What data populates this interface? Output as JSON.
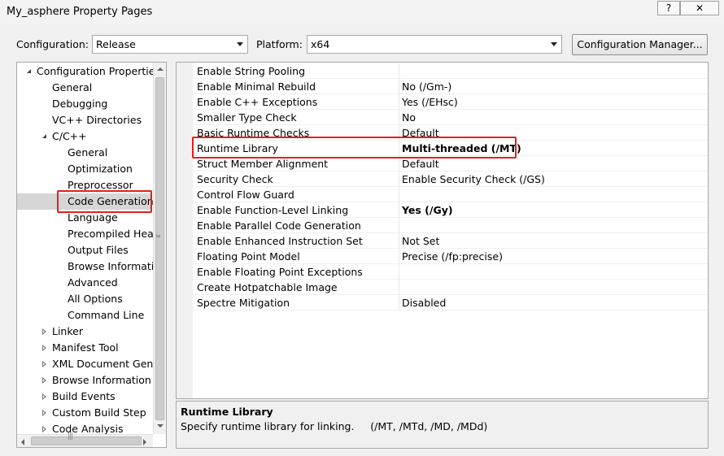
{
  "window": {
    "title": "My_asphere Property Pages",
    "help_glyph": "?",
    "close_glyph": "✕"
  },
  "config": {
    "configuration_label": "Configuration:",
    "configuration_value": "Release",
    "platform_label": "Platform:",
    "platform_value": "x64",
    "manager_button": "Configuration Manager..."
  },
  "tree": {
    "items": [
      {
        "label": "Configuration Properties",
        "level": 0,
        "expander": "open"
      },
      {
        "label": "General",
        "level": 1,
        "expander": "none"
      },
      {
        "label": "Debugging",
        "level": 1,
        "expander": "none"
      },
      {
        "label": "VC++ Directories",
        "level": 1,
        "expander": "none"
      },
      {
        "label": "C/C++",
        "level": 1,
        "expander": "open"
      },
      {
        "label": "General",
        "level": 2,
        "expander": "none"
      },
      {
        "label": "Optimization",
        "level": 2,
        "expander": "none"
      },
      {
        "label": "Preprocessor",
        "level": 2,
        "expander": "none"
      },
      {
        "label": "Code Generation",
        "level": 2,
        "expander": "none",
        "selected": true
      },
      {
        "label": "Language",
        "level": 2,
        "expander": "none"
      },
      {
        "label": "Precompiled Head",
        "level": 2,
        "expander": "none"
      },
      {
        "label": "Output Files",
        "level": 2,
        "expander": "none"
      },
      {
        "label": "Browse Informatio",
        "level": 2,
        "expander": "none"
      },
      {
        "label": "Advanced",
        "level": 2,
        "expander": "none"
      },
      {
        "label": "All Options",
        "level": 2,
        "expander": "none"
      },
      {
        "label": "Command Line",
        "level": 2,
        "expander": "none"
      },
      {
        "label": "Linker",
        "level": 1,
        "expander": "closed"
      },
      {
        "label": "Manifest Tool",
        "level": 1,
        "expander": "closed"
      },
      {
        "label": "XML Document Gene",
        "level": 1,
        "expander": "closed"
      },
      {
        "label": "Browse Information",
        "level": 1,
        "expander": "closed"
      },
      {
        "label": "Build Events",
        "level": 1,
        "expander": "closed"
      },
      {
        "label": "Custom Build Step",
        "level": 1,
        "expander": "closed"
      },
      {
        "label": "Code Analysis",
        "level": 1,
        "expander": "closed"
      }
    ]
  },
  "properties": [
    {
      "name": "Enable String Pooling",
      "value": ""
    },
    {
      "name": "Enable Minimal Rebuild",
      "value": "No (/Gm-)"
    },
    {
      "name": "Enable C++ Exceptions",
      "value": "Yes (/EHsc)"
    },
    {
      "name": "Smaller Type Check",
      "value": "No"
    },
    {
      "name": "Basic Runtime Checks",
      "value": "Default"
    },
    {
      "name": "Runtime Library",
      "value": "Multi-threaded (/MT)",
      "bold": true,
      "highlighted": true
    },
    {
      "name": "Struct Member Alignment",
      "value": "Default"
    },
    {
      "name": "Security Check",
      "value": "Enable Security Check (/GS)"
    },
    {
      "name": "Control Flow Guard",
      "value": ""
    },
    {
      "name": "Enable Function-Level Linking",
      "value": "Yes (/Gy)",
      "bold": true
    },
    {
      "name": "Enable Parallel Code Generation",
      "value": ""
    },
    {
      "name": "Enable Enhanced Instruction Set",
      "value": "Not Set"
    },
    {
      "name": "Floating Point Model",
      "value": "Precise (/fp:precise)"
    },
    {
      "name": "Enable Floating Point Exceptions",
      "value": ""
    },
    {
      "name": "Create Hotpatchable Image",
      "value": ""
    },
    {
      "name": "Spectre Mitigation",
      "value": "Disabled"
    }
  ],
  "description": {
    "title": "Runtime Library",
    "text": "Specify runtime library for linking.     (/MT, /MTd, /MD, /MDd)"
  },
  "colors": {
    "highlight": "#e0211d",
    "selection": "#d6d6d6"
  }
}
